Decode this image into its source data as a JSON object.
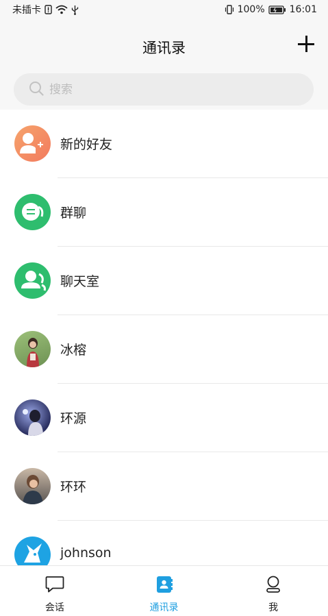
{
  "status_bar": {
    "carrier": "未插卡",
    "battery": "100%",
    "time": "16:01"
  },
  "header": {
    "title": "通讯录",
    "add_icon": "plus-icon"
  },
  "search": {
    "placeholder": "搜索",
    "value": ""
  },
  "contacts": [
    {
      "label": "新的好友",
      "avatar": "new-friend-icon",
      "color": "#f48a62"
    },
    {
      "label": "群聊",
      "avatar": "group-chat-icon",
      "color": "#2ebd6e"
    },
    {
      "label": "聊天室",
      "avatar": "chatroom-icon",
      "color": "#2ebd6e"
    },
    {
      "label": "冰榕",
      "avatar": "user-photo",
      "color": "#8fb36a"
    },
    {
      "label": "环源",
      "avatar": "user-photo",
      "color": "#3a3f7a"
    },
    {
      "label": "环环",
      "avatar": "user-photo",
      "color": "#6f6a66"
    },
    {
      "label": "johnson",
      "avatar": "unicorn-icon",
      "color": "#1ea3e3"
    }
  ],
  "tabs": [
    {
      "label": "会话",
      "icon": "chat-bubble-icon",
      "active": false
    },
    {
      "label": "通讯录",
      "icon": "contacts-book-icon",
      "active": true
    },
    {
      "label": "我",
      "icon": "person-icon",
      "active": false
    }
  ],
  "colors": {
    "accent": "#1f9fe0",
    "header_bg": "#f7f7f7",
    "search_bg": "#ececec"
  }
}
